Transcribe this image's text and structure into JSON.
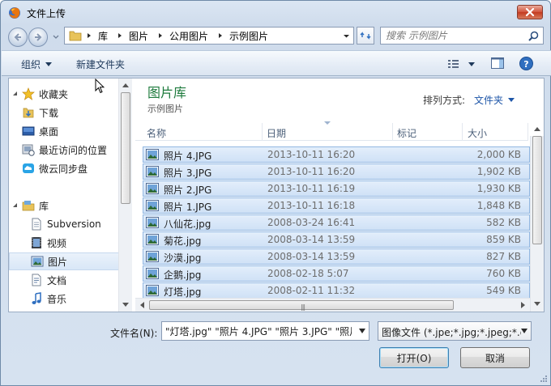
{
  "window": {
    "title": "文件上传"
  },
  "address": {
    "crumbs": [
      "库",
      "图片",
      "公用图片",
      "示例图片"
    ]
  },
  "search": {
    "placeholder": "搜索 示例图片"
  },
  "toolbar": {
    "organize_label": "组织",
    "new_folder_label": "新建文件夹"
  },
  "navpane": {
    "items": [
      {
        "label": "收藏夹",
        "icon": "star-icon"
      },
      {
        "label": "下载",
        "icon": "download-folder-icon"
      },
      {
        "label": "桌面",
        "icon": "desktop-icon"
      },
      {
        "label": "最近访问的位置",
        "icon": "recent-places-icon"
      },
      {
        "label": "微云同步盘",
        "icon": "weiyun-icon"
      },
      {
        "label": "库",
        "icon": "library-icon"
      },
      {
        "label": "Subversion",
        "icon": "document-library-icon"
      },
      {
        "label": "视频",
        "icon": "video-library-icon"
      },
      {
        "label": "图片",
        "icon": "pictures-library-icon"
      },
      {
        "label": "文档",
        "icon": "documents-library-icon"
      },
      {
        "label": "音乐",
        "icon": "music-library-icon"
      }
    ]
  },
  "library": {
    "title": "图片库",
    "subtitle": "示例图片",
    "arrange_label": "排列方式:",
    "arrange_value": "文件夹"
  },
  "columns": {
    "name": "名称",
    "date": "日期",
    "tags": "标记",
    "size": "大小"
  },
  "files": [
    {
      "name": "照片 4.JPG",
      "date": "2013-10-11 16:20",
      "size": "2,000 KB"
    },
    {
      "name": "照片 3.JPG",
      "date": "2013-10-11 16:20",
      "size": "1,902 KB"
    },
    {
      "name": "照片 2.JPG",
      "date": "2013-10-11 16:19",
      "size": "1,930 KB"
    },
    {
      "name": "照片 1.JPG",
      "date": "2013-10-11 16:18",
      "size": "1,848 KB"
    },
    {
      "name": "八仙花.jpg",
      "date": "2008-03-24 16:41",
      "size": "582 KB"
    },
    {
      "name": "菊花.jpg",
      "date": "2008-03-14 13:59",
      "size": "859 KB"
    },
    {
      "name": "沙漠.jpg",
      "date": "2008-03-14 13:59",
      "size": "827 KB"
    },
    {
      "name": "企鹅.jpg",
      "date": "2008-02-18 5:07",
      "size": "760 KB"
    },
    {
      "name": "灯塔.jpg",
      "date": "2008-02-11 11:32",
      "size": "549 KB"
    }
  ],
  "filename": {
    "label": "文件名(N):",
    "value": "\"灯塔.jpg\" \"照片 4.JPG\" \"照片 3.JPG\" \"照片"
  },
  "filter": {
    "value": "图像文件 (*.jpe;*.jpg;*.jpeg;*.gi"
  },
  "buttons": {
    "open": "打开(O)",
    "cancel": "取消"
  },
  "colors": {
    "accent_green": "#1e7b3d",
    "link_blue": "#1e56a8",
    "selection": "#cfe1f6"
  }
}
